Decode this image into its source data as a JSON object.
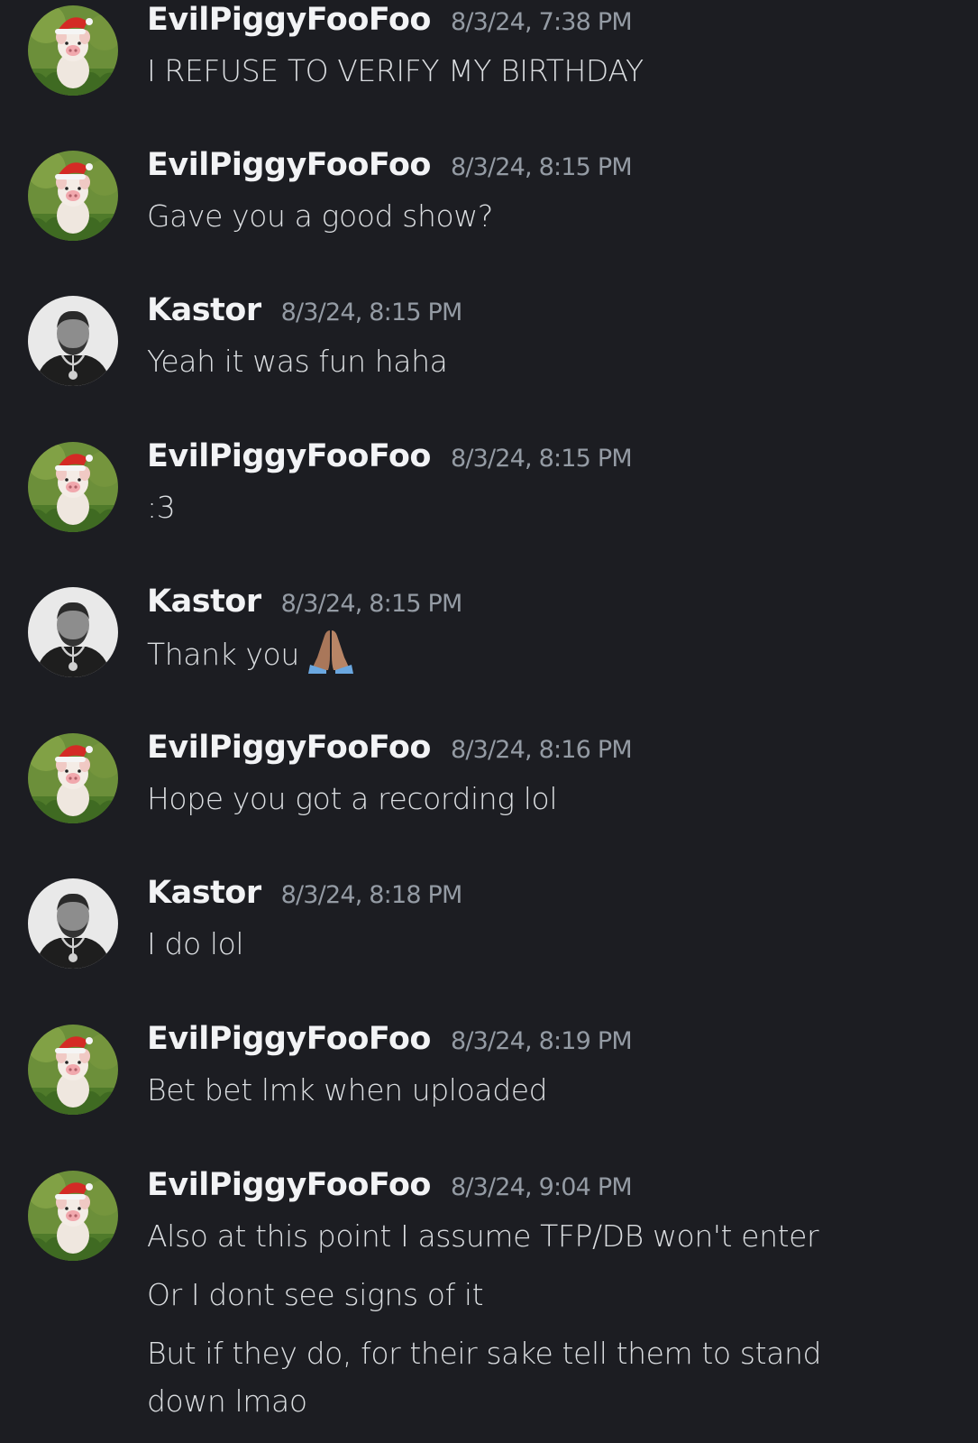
{
  "messages": [
    {
      "author": "EvilPiggyFooFoo",
      "avatar": "pig-santa-hat-avatar",
      "timestamp": "8/3/24, 7:38 PM",
      "lines": [
        "I REFUSE TO VERIFY MY BIRTHDAY"
      ]
    },
    {
      "author": "EvilPiggyFooFoo",
      "avatar": "pig-santa-hat-avatar",
      "timestamp": "8/3/24, 8:15 PM",
      "lines": [
        "Gave you a good show?"
      ]
    },
    {
      "author": "Kastor",
      "avatar": "man-portrait-avatar",
      "timestamp": "8/3/24, 8:15 PM",
      "lines": [
        "Yeah it was fun haha"
      ]
    },
    {
      "author": "EvilPiggyFooFoo",
      "avatar": "pig-santa-hat-avatar",
      "timestamp": "8/3/24, 8:15 PM",
      "lines": [
        ":3"
      ]
    },
    {
      "author": "Kastor",
      "avatar": "man-portrait-avatar",
      "timestamp": "8/3/24, 8:15 PM",
      "lines": [
        "Thank you"
      ],
      "emoji": "folded-hands-emoji"
    },
    {
      "author": "EvilPiggyFooFoo",
      "avatar": "pig-santa-hat-avatar",
      "timestamp": "8/3/24, 8:16 PM",
      "lines": [
        "Hope you got a recording lol"
      ]
    },
    {
      "author": "Kastor",
      "avatar": "man-portrait-avatar",
      "timestamp": "8/3/24, 8:18 PM",
      "lines": [
        "I do lol"
      ]
    },
    {
      "author": "EvilPiggyFooFoo",
      "avatar": "pig-santa-hat-avatar",
      "timestamp": "8/3/24, 8:19 PM",
      "lines": [
        "Bet bet lmk when uploaded"
      ]
    },
    {
      "author": "EvilPiggyFooFoo",
      "avatar": "pig-santa-hat-avatar",
      "timestamp": "8/3/24, 9:04 PM",
      "lines": [
        "Also at this point I assume TFP/DB won't enter",
        "Or I dont see signs of it",
        "But if they do, for their sake tell them to stand down lmao"
      ]
    }
  ],
  "colors": {
    "background": "#1c1d22",
    "username": "#f2f3f5",
    "timestamp": "#949ba4",
    "message_text": "#dbdee1"
  }
}
